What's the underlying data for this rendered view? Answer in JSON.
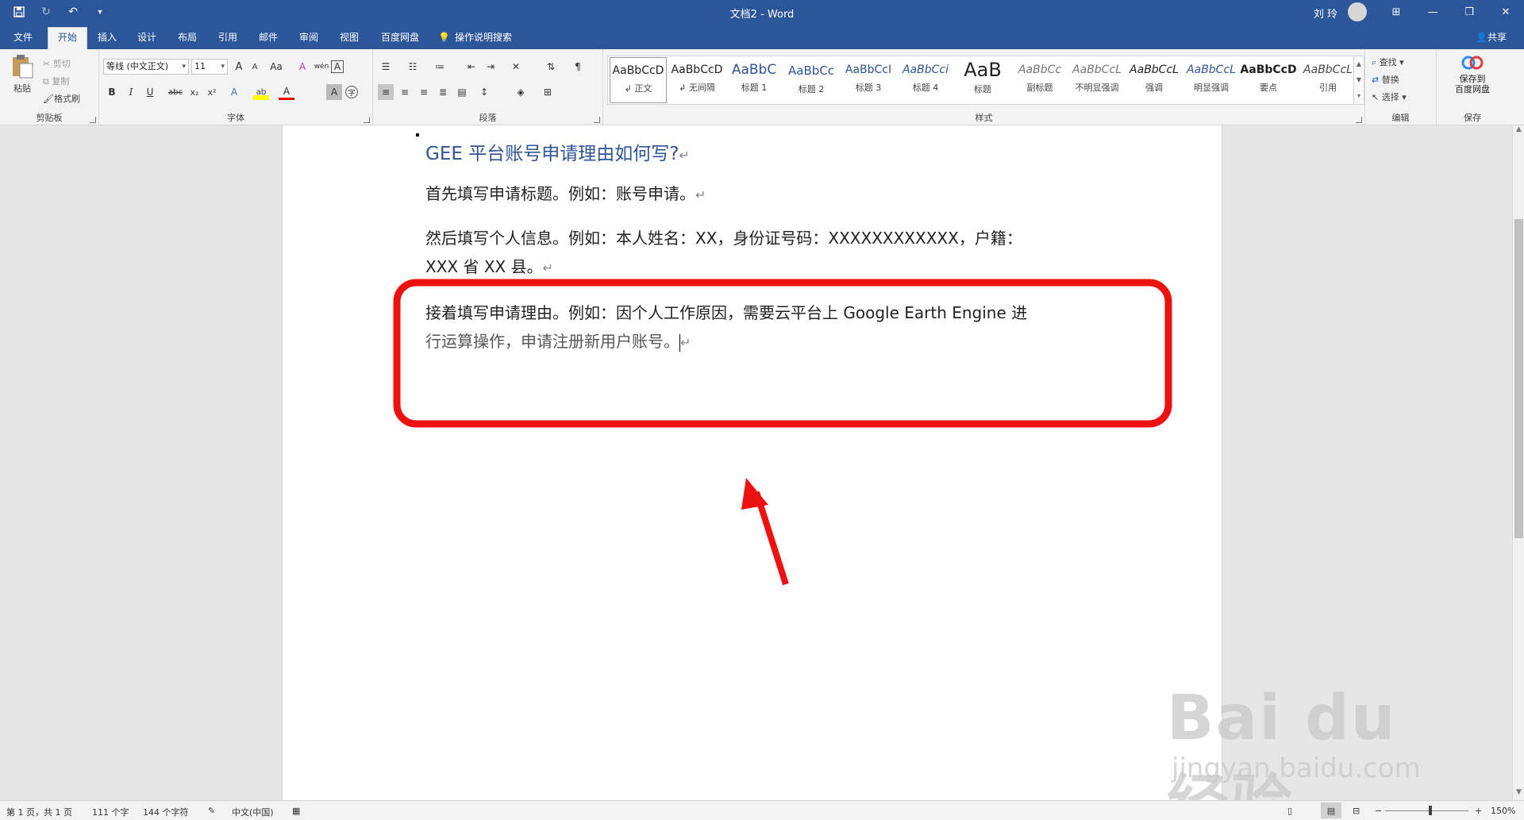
{
  "window": {
    "title": "文档2 - Word",
    "user": "刘 玲",
    "minimize": "—",
    "restore": "❐",
    "close": "✕",
    "ribbon_display": "⊞"
  },
  "quick_access": {
    "save": "💾",
    "redo": "↻",
    "undo": "↶",
    "customize": "▾"
  },
  "tabs": [
    "文件",
    "开始",
    "插入",
    "设计",
    "布局",
    "引用",
    "邮件",
    "审阅",
    "视图",
    "百度网盘",
    "操作说明搜索"
  ],
  "active_tab": "开始",
  "share": "共享",
  "clipboard": {
    "group_label": "剪贴板",
    "paste": "粘贴",
    "cut": "剪切",
    "copy": "复制",
    "format_painter": "格式刷"
  },
  "font": {
    "group_label": "字体",
    "font_name": "等线 (中文正文)",
    "font_size": "11",
    "grow": "A",
    "shrink": "A",
    "change_case": "Aa",
    "clear_format": "A",
    "phonetic": "wén",
    "char_border": "A",
    "bold": "B",
    "italic": "I",
    "underline": "U",
    "strike": "abc",
    "subscript": "x₂",
    "superscript": "x²",
    "text_effects": "A",
    "highlight": "ab",
    "font_color": "A",
    "char_shading": "A",
    "enclose": "字"
  },
  "paragraph": {
    "group_label": "段落"
  },
  "styles": {
    "group_label": "样式",
    "items": [
      {
        "sample": "AaBbCcD",
        "name": "↲ 正文"
      },
      {
        "sample": "AaBbCcD",
        "name": "↲ 无间隔"
      },
      {
        "sample": "AaBbC",
        "name": "标题 1"
      },
      {
        "sample": "AaBbCc",
        "name": "标题 2"
      },
      {
        "sample": "AaBbCcI",
        "name": "标题 3"
      },
      {
        "sample": "AaBbCci",
        "name": "标题 4"
      },
      {
        "sample": "AaB",
        "name": "标题"
      },
      {
        "sample": "AaBbCc",
        "name": "副标题"
      },
      {
        "sample": "AaBbCcL",
        "name": "不明显强调"
      },
      {
        "sample": "AaBbCcL",
        "name": "强调"
      },
      {
        "sample": "AaBbCcL",
        "name": "明显强调"
      },
      {
        "sample": "AaBbCcD",
        "name": "要点"
      },
      {
        "sample": "AaBbCcL",
        "name": "引用"
      }
    ]
  },
  "editing": {
    "group_label": "编辑",
    "find": "查找",
    "replace": "替换",
    "select": "选择"
  },
  "save_group": {
    "group_label": "保存",
    "button": "保存到\n百度网盘"
  },
  "document": {
    "heading": "GEE 平台账号申请理由如何写?",
    "para1": "首先填写申请标题。例如：账号申请。",
    "para2_line1": "然后填写个人信息。例如：本人姓名：XX，身份证号码：XXXXXXXXXXXX，户籍：",
    "para2_line2": "XXX 省 XX 县。",
    "para3_line1": "接着填写申请理由。例如：因个人工作原因，需要云平台上 Google Earth Engine 进",
    "para3_line2": "行运算操作，申请注册新用户账号。",
    "para_mark": "↵"
  },
  "annotation": {
    "color": "#ee1111"
  },
  "status": {
    "page": "第 1 页，共 1 页",
    "words": "111 个字",
    "chars": "144 个字符",
    "language": "中文(中国)",
    "zoom": "150%",
    "zoom_minus": "−",
    "zoom_plus": "+"
  },
  "watermark": {
    "logo": "Bai du 经验",
    "url": "jingyan.baidu.com"
  },
  "colors": {
    "word_blue": "#2b579a",
    "heading_blue": "#2f5496"
  }
}
